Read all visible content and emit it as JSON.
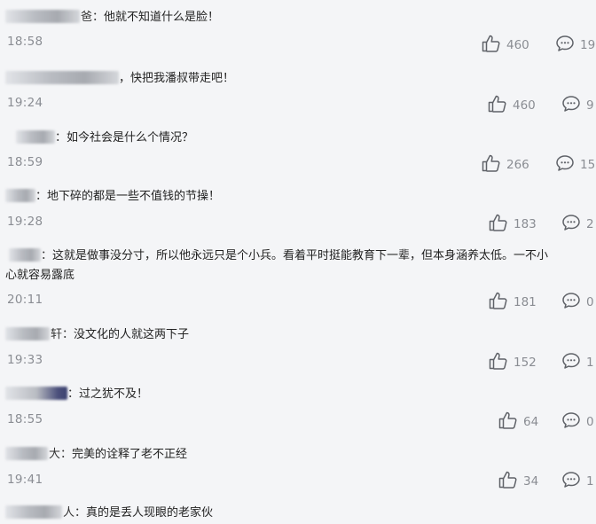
{
  "comments": [
    {
      "name_suffix": "爸",
      "text": "他就不知道什么是脸！",
      "time": "18:58",
      "likes": "460",
      "replies": "19"
    },
    {
      "name_suffix": "",
      "text": "，快把我潘叔带走吧！",
      "time": "19:24",
      "likes": "460",
      "replies": "9"
    },
    {
      "name_suffix": "",
      "text": "如今社会是什么个情况？",
      "time": "18:59",
      "likes": "266",
      "replies": "15"
    },
    {
      "name_suffix": "",
      "text": "地下碎的都是一些不值钱的节操！",
      "time": "19:28",
      "likes": "183",
      "replies": "2"
    },
    {
      "name_suffix": "",
      "text": "这就是做事没分寸，所以他永远只是个小兵。看着平时挺能教育下一辈，但本身涵养太低。一不小",
      "text2": "心就容易露底",
      "time": "20:11",
      "likes": "181",
      "replies": "0"
    },
    {
      "name_suffix": "轩",
      "text": "没文化的人就这两下子",
      "time": "19:33",
      "likes": "152",
      "replies": "1"
    },
    {
      "name_suffix": "",
      "text": "过之犹不及！",
      "time": "18:55",
      "likes": "64",
      "replies": "0"
    },
    {
      "name_suffix": "大",
      "text": "完美的诠释了老不正经",
      "time": "19:41",
      "likes": "34",
      "replies": "1"
    },
    {
      "name_suffix": "人",
      "text": "真的是丢人现眼的老家伙",
      "time": "",
      "likes": "",
      "replies": ""
    }
  ],
  "labels": {
    "colon": "："
  },
  "icons": {
    "like": "thumbs-up-icon",
    "reply": "comment-bubble-icon"
  },
  "colors": {
    "background": "#f4f5f7",
    "meta": "#8a8d93",
    "text": "#222222"
  }
}
